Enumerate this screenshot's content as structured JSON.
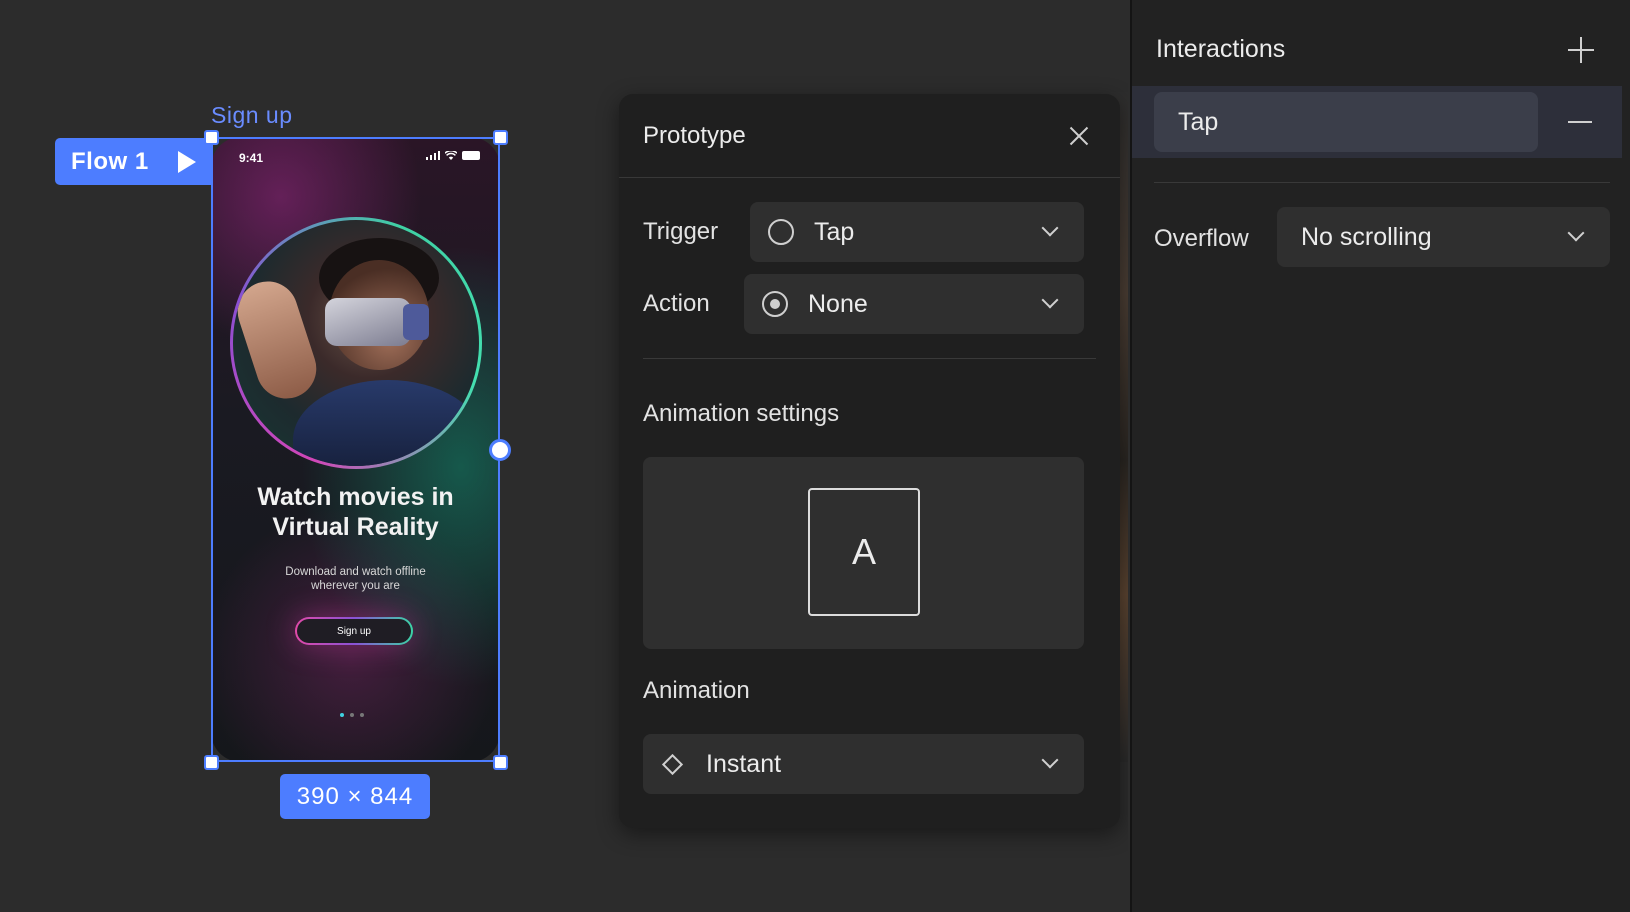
{
  "canvas": {
    "frame_label": "Sign up",
    "flow_tag": "Flow 1",
    "size_badge": "390 × 844",
    "phone": {
      "time": "9:41",
      "title": "Watch movies in Virtual Reality",
      "subtitle_line1": "Download and watch offline",
      "subtitle_line2": "wherever you are",
      "button": "Sign up"
    }
  },
  "prototype": {
    "title": "Prototype",
    "trigger_label": "Trigger",
    "trigger_value": "Tap",
    "action_label": "Action",
    "action_value": "None",
    "animation_settings_label": "Animation settings",
    "preview_letter": "A",
    "animation_label": "Animation",
    "animation_value": "Instant"
  },
  "sidebar": {
    "title": "Interactions",
    "interaction_item": "Tap",
    "overflow_label": "Overflow",
    "overflow_value": "No scrolling"
  },
  "colors": {
    "accent": "#4d7dff",
    "panel": "#1f1f1f",
    "canvas": "#2c2c2c"
  }
}
